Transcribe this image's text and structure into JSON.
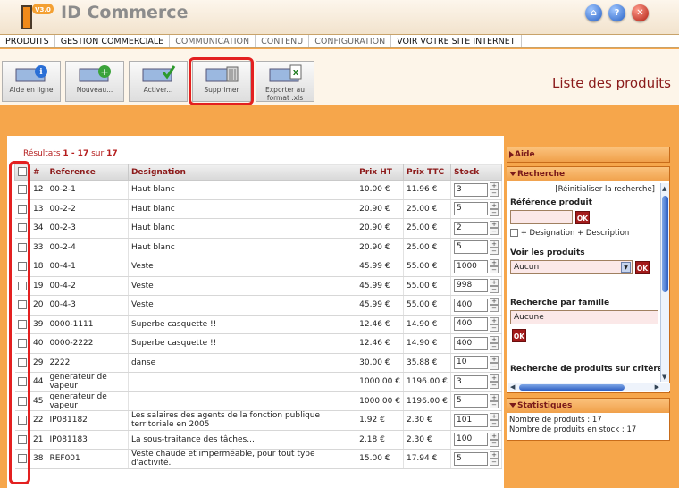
{
  "app": {
    "logo_badge": "V3.0",
    "title": "ID Commerce"
  },
  "top_icons": [
    "home-icon",
    "help-icon",
    "close-icon"
  ],
  "menu": [
    {
      "label": "PRODUITS",
      "style": "dark"
    },
    {
      "label": "GESTION COMMERCIALE",
      "style": "dark"
    },
    {
      "label": "COMMUNICATION",
      "style": "light"
    },
    {
      "label": "CONTENU",
      "style": "light"
    },
    {
      "label": "CONFIGURATION",
      "style": "light"
    },
    {
      "label": "VOIR VOTRE SITE INTERNET",
      "style": "dark"
    }
  ],
  "toolbar": {
    "help": "Aide en ligne",
    "new": "Nouveau...",
    "activate": "Activer...",
    "delete": "Supprimer",
    "export_line1": "Exporter au",
    "export_line2": "format .xls"
  },
  "page_title": "Liste des produits",
  "results": {
    "prefix": "Résultats",
    "range": "1 - 17",
    "sep": "sur",
    "total": "17"
  },
  "table": {
    "headers": [
      "#",
      "Reference",
      "Designation",
      "Prix HT",
      "Prix TTC",
      "Stock"
    ],
    "rows": [
      {
        "id": "12",
        "ref": "00-2-1",
        "designation": "Haut blanc",
        "ht": "10.00 €",
        "ttc": "11.96 €",
        "stock": "3"
      },
      {
        "id": "13",
        "ref": "00-2-2",
        "designation": "Haut blanc",
        "ht": "20.90 €",
        "ttc": "25.00 €",
        "stock": "5"
      },
      {
        "id": "34",
        "ref": "00-2-3",
        "designation": "Haut blanc",
        "ht": "20.90 €",
        "ttc": "25.00 €",
        "stock": "2"
      },
      {
        "id": "33",
        "ref": "00-2-4",
        "designation": "Haut blanc",
        "ht": "20.90 €",
        "ttc": "25.00 €",
        "stock": "5"
      },
      {
        "id": "18",
        "ref": "00-4-1",
        "designation": "Veste",
        "ht": "45.99 €",
        "ttc": "55.00 €",
        "stock": "1000"
      },
      {
        "id": "19",
        "ref": "00-4-2",
        "designation": "Veste",
        "ht": "45.99 €",
        "ttc": "55.00 €",
        "stock": "998"
      },
      {
        "id": "20",
        "ref": "00-4-3",
        "designation": "Veste",
        "ht": "45.99 €",
        "ttc": "55.00 €",
        "stock": "400"
      },
      {
        "id": "39",
        "ref": "0000-1111",
        "designation": "Superbe casquette !!",
        "ht": "12.46 €",
        "ttc": "14.90 €",
        "stock": "400"
      },
      {
        "id": "40",
        "ref": "0000-2222",
        "designation": "Superbe casquette !!",
        "ht": "12.46 €",
        "ttc": "14.90 €",
        "stock": "400"
      },
      {
        "id": "29",
        "ref": "2222",
        "designation": "danse",
        "ht": "30.00 €",
        "ttc": "35.88 €",
        "stock": "10"
      },
      {
        "id": "44",
        "ref": "generateur de vapeur",
        "designation": "",
        "ht": "1000.00 €",
        "ttc": "1196.00 €",
        "stock": "3"
      },
      {
        "id": "45",
        "ref": "generateur de vapeur",
        "designation": "",
        "ht": "1000.00 €",
        "ttc": "1196.00 €",
        "stock": "5"
      },
      {
        "id": "22",
        "ref": "IP081182",
        "designation": "Les salaires des agents de la fonction publique territoriale en 2005",
        "ht": "1.92 €",
        "ttc": "2.30 €",
        "stock": "101"
      },
      {
        "id": "21",
        "ref": "IP081183",
        "designation": "La sous-traitance des tâches...",
        "ht": "2.18 €",
        "ttc": "2.30 €",
        "stock": "100"
      },
      {
        "id": "38",
        "ref": "REF001",
        "designation": "Veste chaude et imperméable, pour tout type d'activité.",
        "ht": "15.00 €",
        "ttc": "17.94 €",
        "stock": "5"
      }
    ]
  },
  "side": {
    "aide": "Aide",
    "recherche": "Recherche",
    "reset": "[Réinitialiser la recherche]",
    "ref_label": "Référence produit",
    "ok": "OK",
    "designation_check": "+ Designation + Description",
    "voir_label": "Voir les produits",
    "voir_value": "Aucun",
    "famille_label": "Recherche par famille",
    "famille_value": "Aucune",
    "criteres_label": "Recherche de produits sur critères",
    "stats": "Statistiques",
    "stats_line1": "Nombre de produits : 17",
    "stats_line2": "Nombre de produits en stock : 17"
  }
}
